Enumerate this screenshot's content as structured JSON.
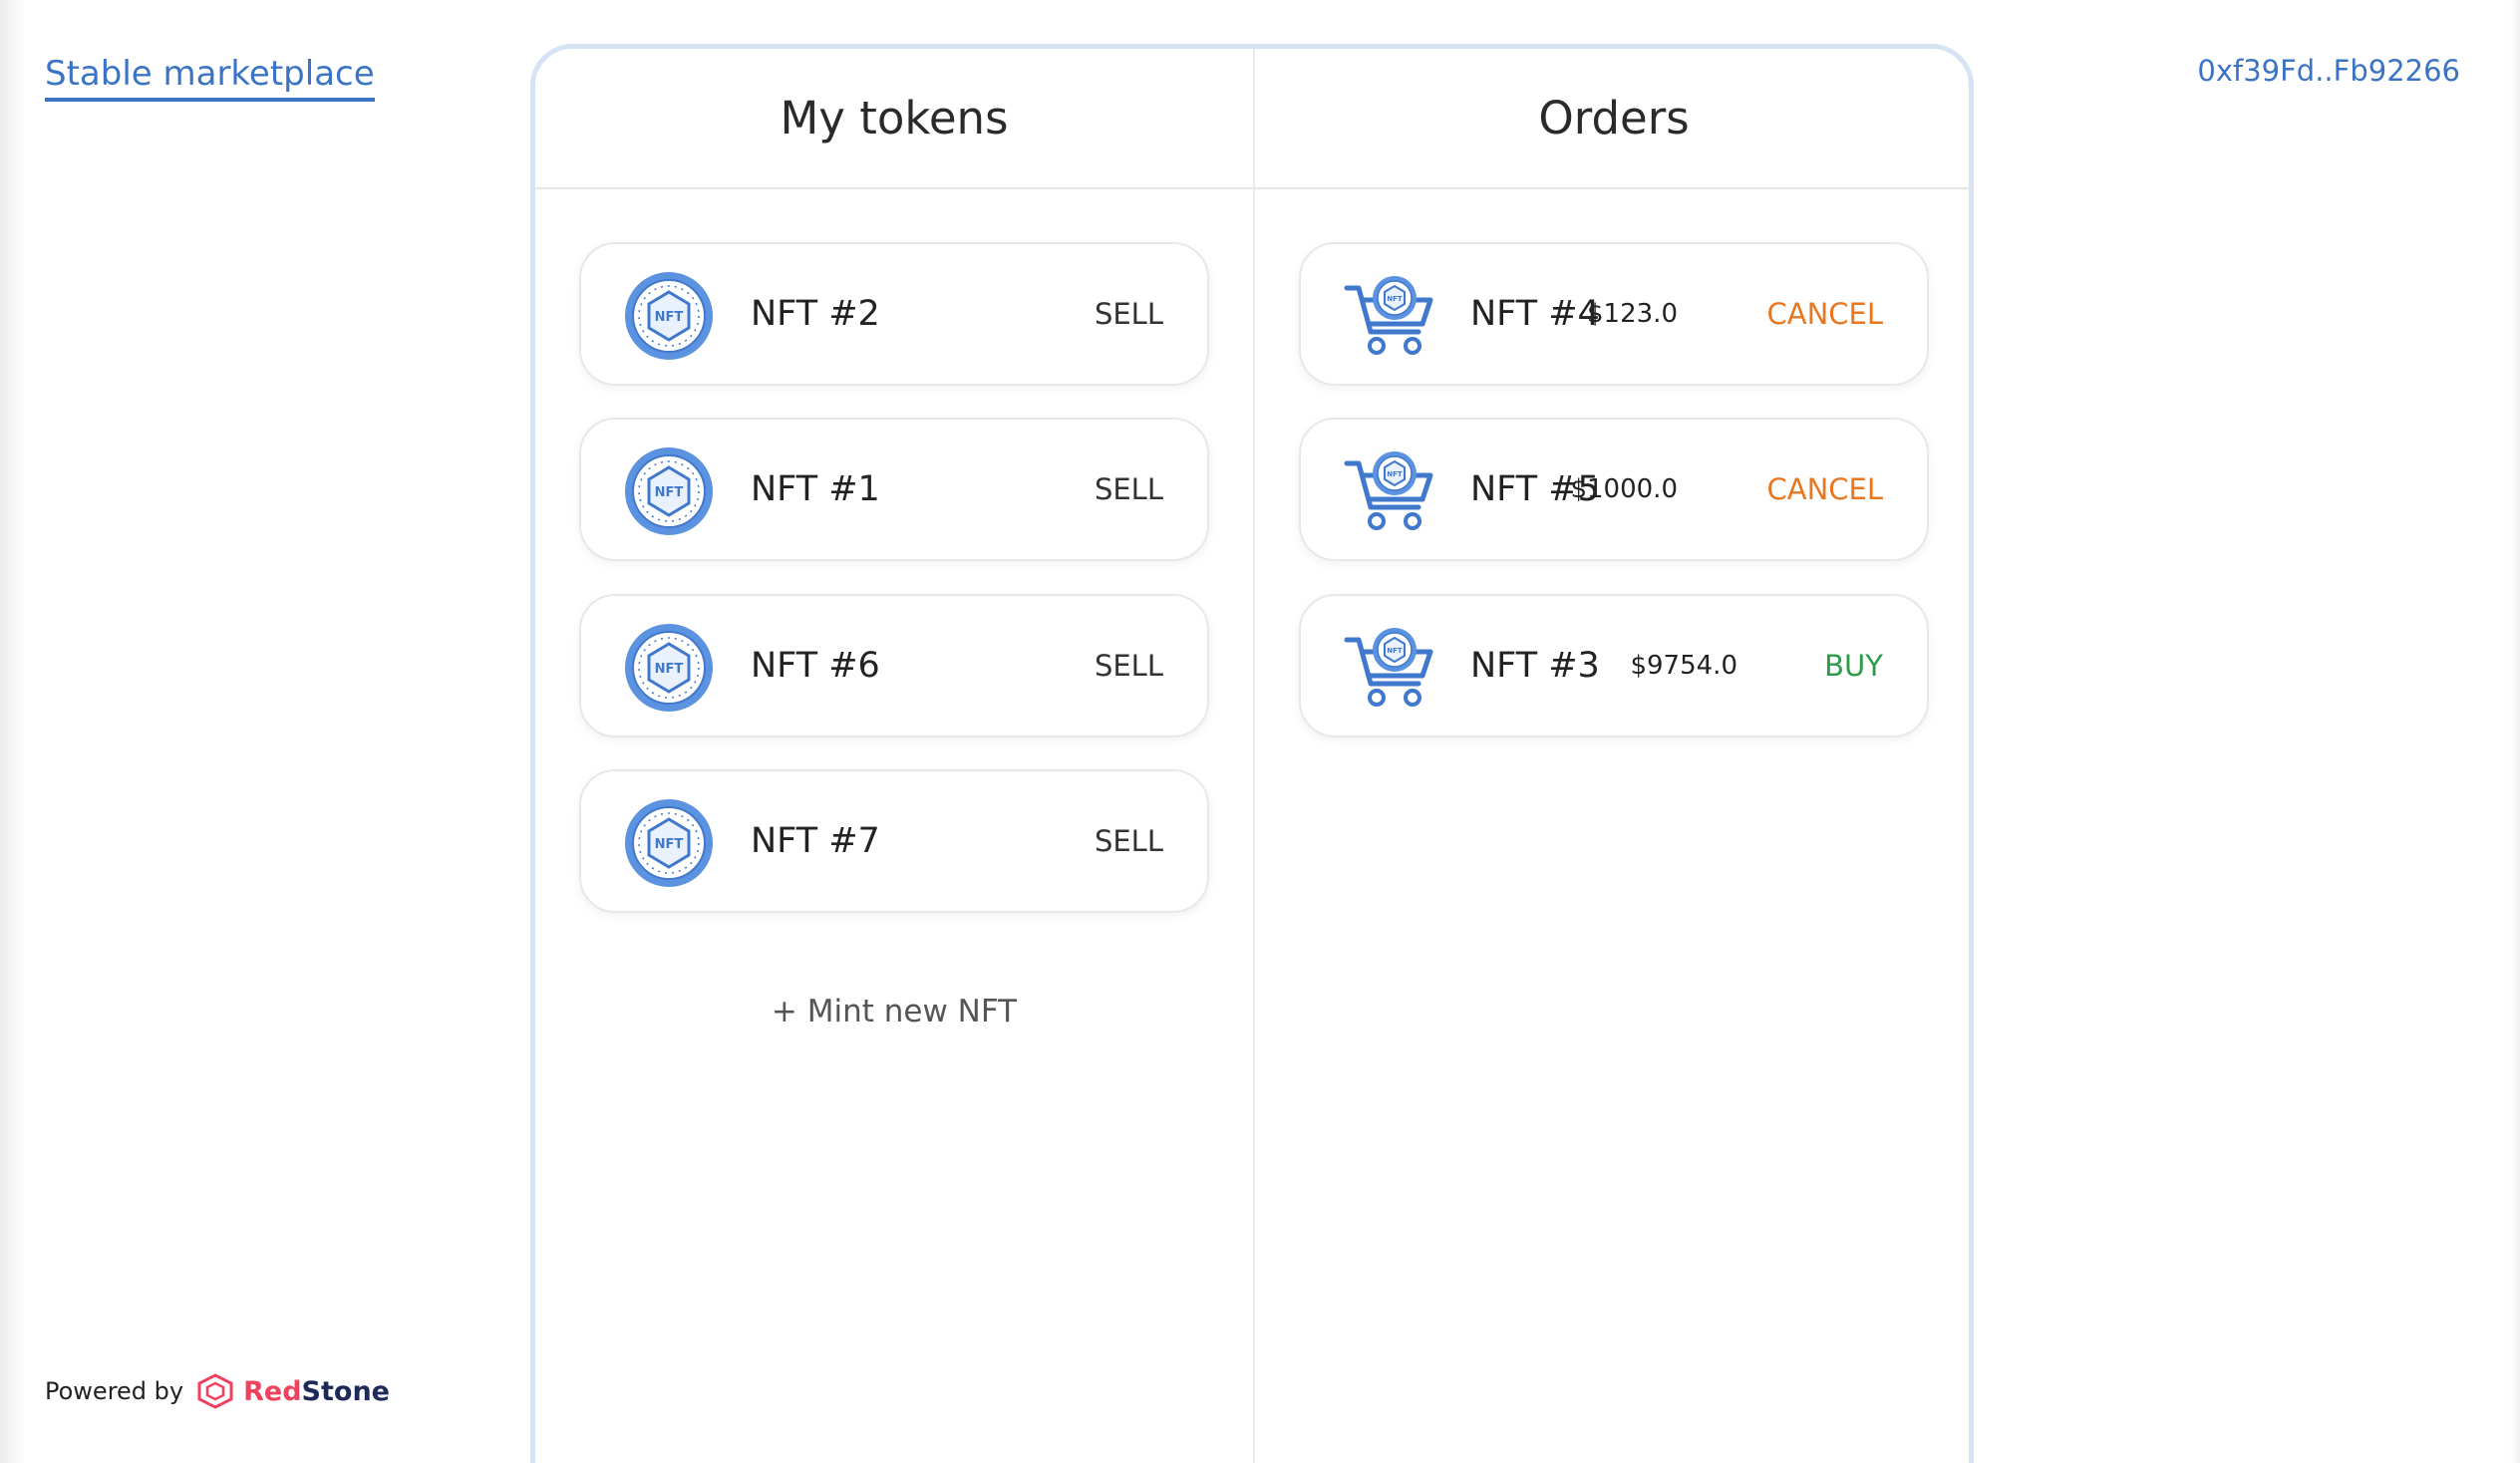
{
  "header": {
    "brand": "Stable marketplace",
    "wallet_address": "0xf39Fd..Fb92266"
  },
  "footer": {
    "powered_by": "Powered by",
    "brand_part1": "Red",
    "brand_part2": "Stone"
  },
  "my_tokens": {
    "title": "My tokens",
    "items": [
      {
        "name": "NFT #2",
        "action": "SELL"
      },
      {
        "name": "NFT #1",
        "action": "SELL"
      },
      {
        "name": "NFT #6",
        "action": "SELL"
      },
      {
        "name": "NFT #7",
        "action": "SELL"
      }
    ],
    "mint_label": "+ Mint new NFT"
  },
  "orders": {
    "title": "Orders",
    "items": [
      {
        "name": "NFT #4",
        "price": "$123.0",
        "action": "CANCEL"
      },
      {
        "name": "NFT #5",
        "price": "$1000.0",
        "action": "CANCEL"
      },
      {
        "name": "NFT #3",
        "price": "$9754.0",
        "action": "BUY"
      }
    ]
  },
  "icons": {
    "token": "nft-coin-icon",
    "order": "shopping-cart-nft-icon",
    "logo": "redstone-logo-icon"
  },
  "colors": {
    "accent_blue": "#3b74c4",
    "cancel_orange": "#e87722",
    "buy_green": "#2e9b48",
    "panel_border": "#d5e3f5"
  }
}
